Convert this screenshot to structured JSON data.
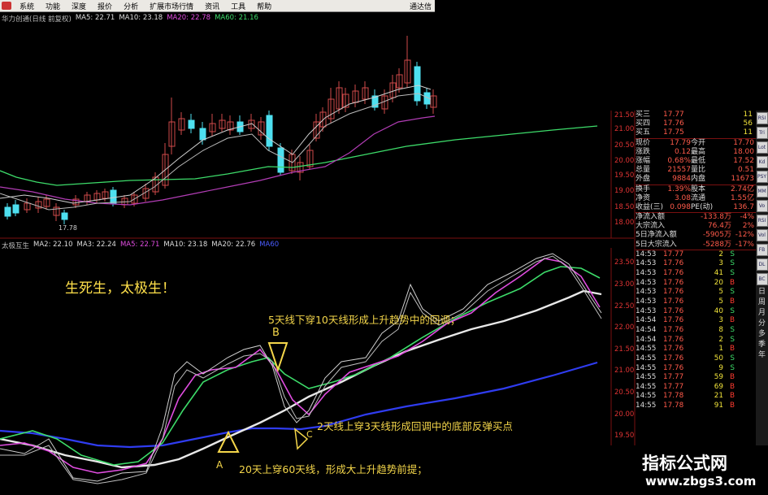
{
  "menu": {
    "items": [
      "系统",
      "功能",
      "深度",
      "报价",
      "分析",
      "扩展市场行情",
      "资讯",
      "工具",
      "帮助"
    ],
    "right_label": "通达信"
  },
  "main_header": {
    "name": "华力创通(日线 前复权)",
    "ma5": "MA5: 22.71",
    "ma10": "MA10: 23.18",
    "ma20": "MA20: 22.78",
    "ma60": "MA60: 21.16"
  },
  "low_marker": "17.78",
  "main_axis": [
    "21.50",
    "21.00",
    "20.50",
    "20.00",
    "19.50",
    "19.00",
    "18.50",
    "18.00"
  ],
  "indicator_header": {
    "name": "太极互生",
    "ma2": "MA2: 22.10",
    "ma3": "MA3: 22.24",
    "ma5": "MA5: 22.71",
    "ma10": "MA10: 23.18",
    "ma20": "MA20: 22.76",
    "ma60": "MA60"
  },
  "indicator_axis": [
    "23.50",
    "23.00",
    "22.50",
    "22.00",
    "21.50",
    "21.00",
    "20.50",
    "20.00",
    "19.50"
  ],
  "annotations": {
    "title": "生死生，太极生！",
    "b_label": "B",
    "b_text": "5天线下穿10天线形成上升趋势中的回调；",
    "c_label": "C",
    "c_text": "2天线上穿3天线形成回调中的底部反弹买点",
    "a_label": "A",
    "a_text": "20天上穿60天线，形成大上升趋势前提；"
  },
  "quote_panel": {
    "asks": [
      {
        "label": "买三",
        "price": "17.77",
        "vol": "11"
      },
      {
        "label": "买四",
        "price": "17.76",
        "vol": "56"
      },
      {
        "label": "买五",
        "price": "17.75",
        "vol": "11"
      }
    ],
    "stats": [
      {
        "l1": "现价",
        "v1": "17.79",
        "l2": "今开",
        "v2": "17.70"
      },
      {
        "l1": "涨跌",
        "v1": "0.12",
        "l2": "最高",
        "v2": "18.00"
      },
      {
        "l1": "涨幅",
        "v1": "0.68%",
        "l2": "最低",
        "v2": "17.52"
      },
      {
        "l1": "总量",
        "v1": "21557",
        "l2": "量比",
        "v2": "0.51"
      },
      {
        "l1": "外盘",
        "v1": "9884",
        "l2": "内盘",
        "v2": "11673"
      },
      {
        "l1": "换手",
        "v1": "1.39%",
        "l2": "股本",
        "v2": "2.74亿"
      },
      {
        "l1": "净资",
        "v1": "3.08",
        "l2": "流通",
        "v2": "1.55亿"
      },
      {
        "l1": "收益(三)",
        "v1": "0.098",
        "l2": "PE(动)",
        "v2": "136.7"
      }
    ],
    "flows": [
      {
        "l": "净流入额",
        "v": "-133.8万",
        "p": "-4%"
      },
      {
        "l": "大宗流入",
        "v": "76.4万",
        "p": "2%"
      },
      {
        "l": "5日净流入额",
        "v": "-5905万",
        "p": "-12%"
      },
      {
        "l": "5日大宗流入",
        "v": "-5288万",
        "p": "-17%"
      }
    ],
    "ticks": [
      [
        "14:53",
        "17.77",
        "2",
        "S"
      ],
      [
        "14:53",
        "17.76",
        "3",
        "S"
      ],
      [
        "14:53",
        "17.76",
        "41",
        "S"
      ],
      [
        "14:53",
        "17.76",
        "20",
        "B"
      ],
      [
        "14:53",
        "17.76",
        "5",
        "S"
      ],
      [
        "14:53",
        "17.76",
        "5",
        "B"
      ],
      [
        "14:53",
        "17.76",
        "40",
        "S"
      ],
      [
        "14:54",
        "17.76",
        "3",
        "B"
      ],
      [
        "14:54",
        "17.76",
        "8",
        "S"
      ],
      [
        "14:54",
        "17.76",
        "2",
        "S"
      ],
      [
        "14:55",
        "17.76",
        "1",
        "B"
      ],
      [
        "14:55",
        "17.76",
        "50",
        "S"
      ],
      [
        "14:55",
        "17.76",
        "9",
        "S"
      ],
      [
        "14:55",
        "17.77",
        "59",
        "B"
      ],
      [
        "14:55",
        "17.77",
        "69",
        "B"
      ],
      [
        "14:55",
        "17.78",
        "21",
        "B"
      ],
      [
        "14:55",
        "17.78",
        "91",
        "B"
      ]
    ]
  },
  "sidebar": {
    "buttons": [
      "RSI",
      "Tri",
      "Lot",
      "Kd",
      "PSY",
      "MM",
      "Vo",
      "RSI",
      "Vol",
      "FB",
      "DL",
      "BC"
    ],
    "vertical_text": [
      "日",
      "周",
      "月",
      "分",
      "多",
      "季",
      "年"
    ]
  },
  "watermark": {
    "line1": "指标公式网",
    "line2": "www.zbgs3.com"
  },
  "colors": {
    "ma_white": "#dddddd",
    "ma_magenta": "#e04de0",
    "ma_green": "#3ddc6a",
    "ma_blue": "#2f3cf0",
    "candle_up": "#d14a4a",
    "candle_down": "#4ee0f0",
    "annotation": "#f4d64a",
    "axis": "#d33333"
  }
}
